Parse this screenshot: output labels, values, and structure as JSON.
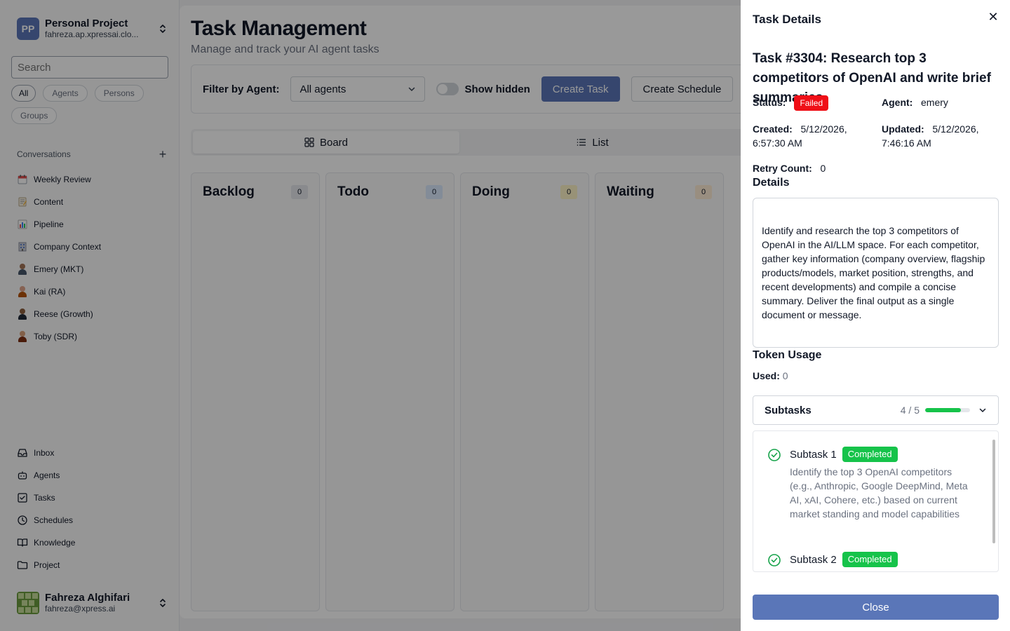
{
  "project": {
    "initials": "PP",
    "name": "Personal Project",
    "email": "fahreza.ap.xpressai.clo..."
  },
  "search": {
    "placeholder": "Search"
  },
  "filters": [
    "All",
    "Agents",
    "Persons",
    "Groups"
  ],
  "conversations": {
    "title": "Conversations",
    "items": [
      {
        "label": "Weekly Review",
        "icon": "calendar-emoji"
      },
      {
        "label": "Content",
        "icon": "memo-emoji"
      },
      {
        "label": "Pipeline",
        "icon": "bar-chart-emoji"
      },
      {
        "label": "Company Context",
        "icon": "office-building-emoji"
      },
      {
        "label": "Emery (MKT)",
        "icon": "person-avatar"
      },
      {
        "label": "Kai (RA)",
        "icon": "person-avatar"
      },
      {
        "label": "Reese (Growth)",
        "icon": "person-avatar"
      },
      {
        "label": "Toby (SDR)",
        "icon": "person-avatar"
      }
    ]
  },
  "nav": [
    {
      "label": "Inbox",
      "icon": "inbox-icon"
    },
    {
      "label": "Agents",
      "icon": "bot-icon"
    },
    {
      "label": "Tasks",
      "icon": "check-square-icon"
    },
    {
      "label": "Schedules",
      "icon": "clock-icon"
    },
    {
      "label": "Knowledge",
      "icon": "book-icon"
    },
    {
      "label": "Project",
      "icon": "folder-icon"
    }
  ],
  "user": {
    "name": "Fahreza Alghifari",
    "email": "fahreza@xpress.ai"
  },
  "main": {
    "title": "Task Management",
    "subtitle": "Manage and track your AI agent tasks",
    "filter_label": "Filter by Agent:",
    "agent_select": "All agents",
    "show_hidden": "Show hidden",
    "create_task": "Create Task",
    "create_schedule": "Create Schedule",
    "tabs": [
      "Board",
      "List"
    ],
    "columns": [
      {
        "title": "Backlog",
        "count": "0",
        "color": "#e5e7eb"
      },
      {
        "title": "Todo",
        "count": "0",
        "color": "#dbeafe"
      },
      {
        "title": "Doing",
        "count": "0",
        "color": "#fef3c7"
      },
      {
        "title": "Waiting",
        "count": "0",
        "color": "#ffedd5"
      }
    ]
  },
  "panel": {
    "title": "Task Details",
    "task_title": "Task #3304: Research top 3 competitors of OpenAI and write brief summaries",
    "status_label": "Status:",
    "status": "Failed",
    "agent_label": "Agent:",
    "agent": "emery",
    "created_label": "Created:",
    "created": "5/12/2026, 6:57:30 AM",
    "updated_label": "Updated:",
    "updated": "5/12/2026, 7:46:16 AM",
    "retry_label": "Retry Count:",
    "retry": "0",
    "details_label": "Details",
    "details": "Identify and research the top 3 competitors of OpenAI in the AI/LLM space. For each competitor, gather key information (company overview, flagship products/models, market position, strengths, and recent developments) and compile a concise summary. Deliver the final output as a single document or message.",
    "token_label": "Token Usage",
    "used_label": "Used:",
    "used": "0",
    "subtasks_title": "Subtasks",
    "subtasks_count": "4 / 5",
    "subtasks_progress": 0.8,
    "subtasks": [
      {
        "name": "Subtask 1",
        "status": "Completed",
        "desc": "Identify the top 3 OpenAI competitors (e.g., Anthropic, Google DeepMind, Meta AI, xAI, Cohere, etc.) based on current market standing and model capabilities"
      },
      {
        "name": "Subtask 2",
        "status": "Completed",
        "desc": ""
      }
    ],
    "close_label": "Close"
  },
  "colors": {
    "primary": "#5a76b8",
    "failed": "#ef0f17",
    "completed": "#16c34a"
  }
}
